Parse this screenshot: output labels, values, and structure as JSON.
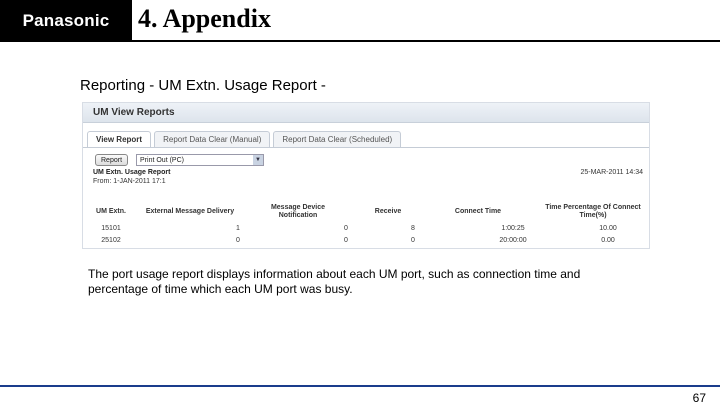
{
  "header": {
    "brand": "Panasonic",
    "title": "4. Appendix"
  },
  "subtitle": "Reporting - UM Extn. Usage Report -",
  "screenshot": {
    "window_title": "UM View Reports",
    "tabs": [
      "View Report",
      "Report Data Clear (Manual)",
      "Report Data Clear (Scheduled)"
    ],
    "report_button": "Report",
    "select_value": "Print Out (PC)",
    "report_title": "UM Extn. Usage Report",
    "report_range": "From: 1-JAN-2011 17:1",
    "report_date": "25-MAR-2011 14:34",
    "columns": [
      "UM Extn.",
      "External Message Delivery",
      "Message Device Notification",
      "Receive",
      "Connect Time",
      "Time Percentage Of Connect Time(%)"
    ],
    "rows": [
      [
        "15101",
        "1",
        "0",
        "8",
        "1:00:25",
        "10.00"
      ],
      [
        "25102",
        "0",
        "0",
        "0",
        "20:00:00",
        "0.00"
      ]
    ]
  },
  "description": "The port usage report displays information about each UM port, such as connection time and percentage of time which each UM port was busy.",
  "page_number": "67",
  "colors": {
    "brand_bg": "#000000",
    "footer_rule": "#1a3c8c"
  }
}
